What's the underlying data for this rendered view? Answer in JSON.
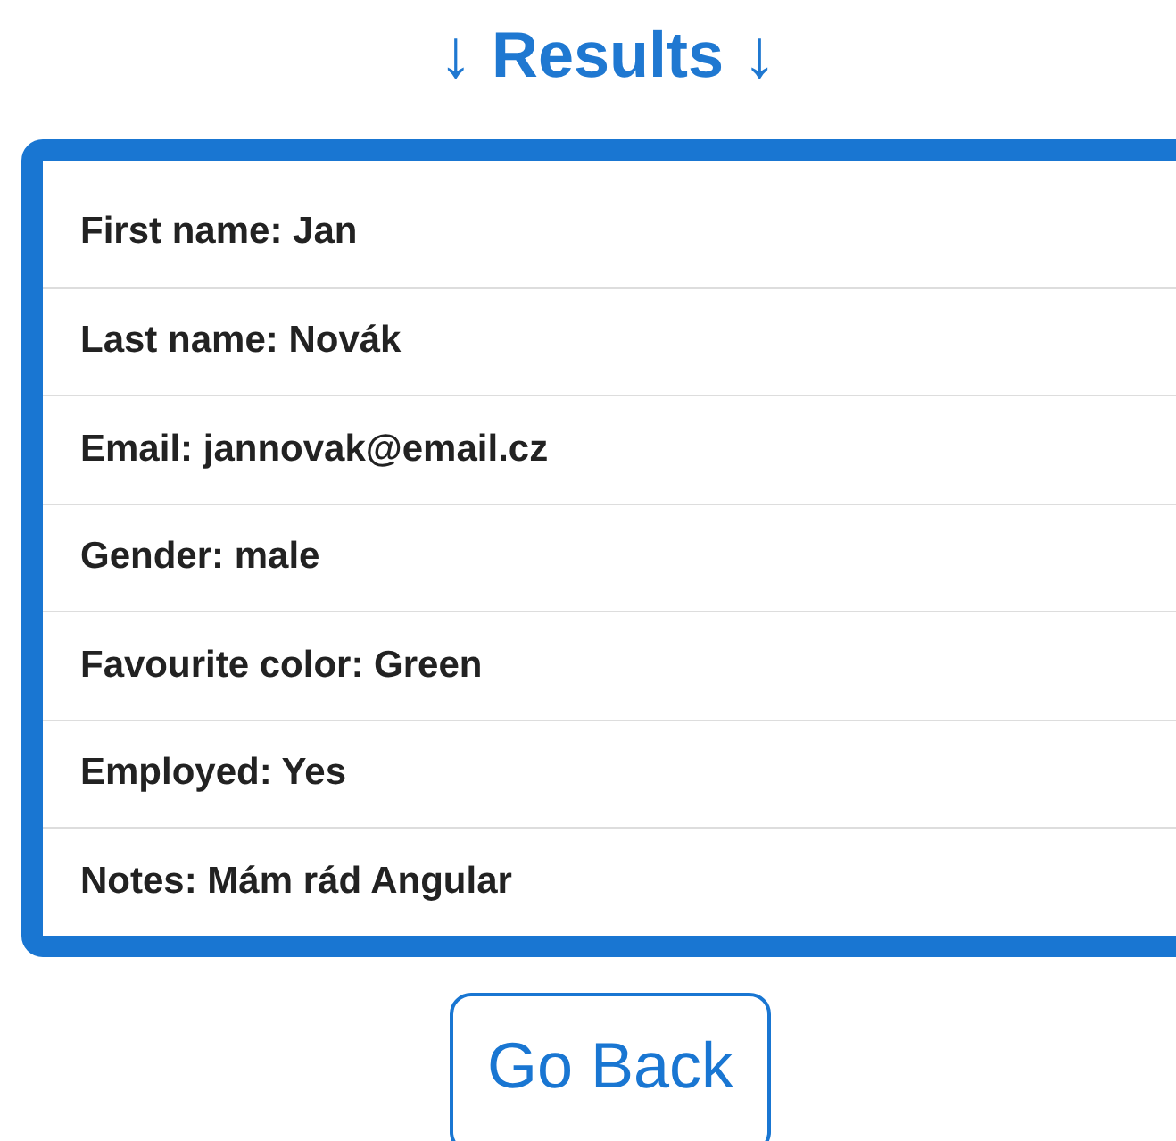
{
  "heading": "↓ **Results** ↓",
  "results": [
    {
      "label": "First name: Jan"
    },
    {
      "label": "Last name: Novák"
    },
    {
      "label": "Email: jannovak@email.cz"
    },
    {
      "label": "Gender: male"
    },
    {
      "label": "Favourite color: Green"
    },
    {
      "label": "Employed: Yes"
    },
    {
      "label": "Notes: Mám rád Angular"
    }
  ],
  "back_button": "Go Back"
}
